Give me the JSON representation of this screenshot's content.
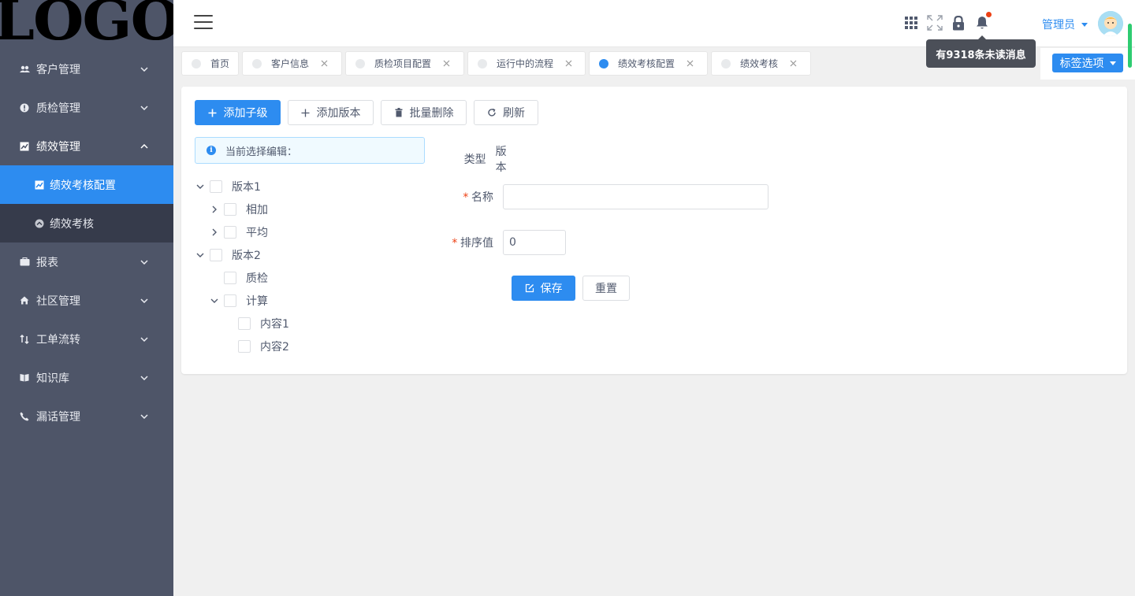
{
  "logo": {
    "text": "LOGO"
  },
  "sidebar": {
    "items": [
      {
        "label": "客户管理",
        "icon": "users-icon"
      },
      {
        "label": "质检管理",
        "icon": "info-circle-icon"
      },
      {
        "label": "绩效管理",
        "icon": "chart-icon",
        "open": true,
        "children": [
          {
            "label": "绩效考核配置",
            "icon": "chart-icon",
            "active": true
          },
          {
            "label": "绩效考核",
            "icon": "circle-up-icon"
          }
        ]
      },
      {
        "label": "报表",
        "icon": "briefcase-icon"
      },
      {
        "label": "社区管理",
        "icon": "home-icon"
      },
      {
        "label": "工单流转",
        "icon": "swap-icon"
      },
      {
        "label": "知识库",
        "icon": "book-icon"
      },
      {
        "label": "漏话管理",
        "icon": "phone-icon"
      }
    ]
  },
  "header": {
    "user_name": "管理员",
    "tooltip": "有9318条未读消息",
    "icons": [
      "apps-icon",
      "fullscreen-icon",
      "lock-icon",
      "bell-icon"
    ]
  },
  "tabs": [
    {
      "label": "首页",
      "closable": false,
      "active": false
    },
    {
      "label": "客户信息",
      "closable": true,
      "active": false
    },
    {
      "label": "质检项目配置",
      "closable": true,
      "active": false
    },
    {
      "label": "运行中的流程",
      "closable": true,
      "active": false
    },
    {
      "label": "绩效考核配置",
      "closable": true,
      "active": true
    },
    {
      "label": "绩效考核",
      "closable": true,
      "active": false
    }
  ],
  "tag_options": "标签选项",
  "toolbar": {
    "add_child": "添加子级",
    "add_version": "添加版本",
    "batch_delete": "批量删除",
    "refresh": "刷新"
  },
  "alert": {
    "text": "当前选择编辑："
  },
  "tree": [
    {
      "label": "版本1",
      "level": 0,
      "expanded": true,
      "hasChildren": true
    },
    {
      "label": "相加",
      "level": 1,
      "expanded": false,
      "hasChildren": true
    },
    {
      "label": "平均",
      "level": 1,
      "expanded": false,
      "hasChildren": true
    },
    {
      "label": "版本2",
      "level": 0,
      "expanded": true,
      "hasChildren": true
    },
    {
      "label": "质检",
      "level": 1,
      "expanded": false,
      "hasChildren": false
    },
    {
      "label": "计算",
      "level": 1,
      "expanded": true,
      "hasChildren": true
    },
    {
      "label": "内容1",
      "level": 2,
      "expanded": false,
      "hasChildren": false
    },
    {
      "label": "内容2",
      "level": 2,
      "expanded": false,
      "hasChildren": false
    }
  ],
  "form": {
    "type_label": "类型",
    "type_value": "版本",
    "name_label": "名称",
    "name_value": "",
    "sort_label": "排序值",
    "sort_value": "0",
    "required_mark": "*",
    "save": "保存",
    "reset": "重置"
  },
  "colors": {
    "primary": "#2d8cf0",
    "sidebar_bg": "#4e5568",
    "submenu_bg": "#363b4b",
    "danger": "#ed4014"
  }
}
